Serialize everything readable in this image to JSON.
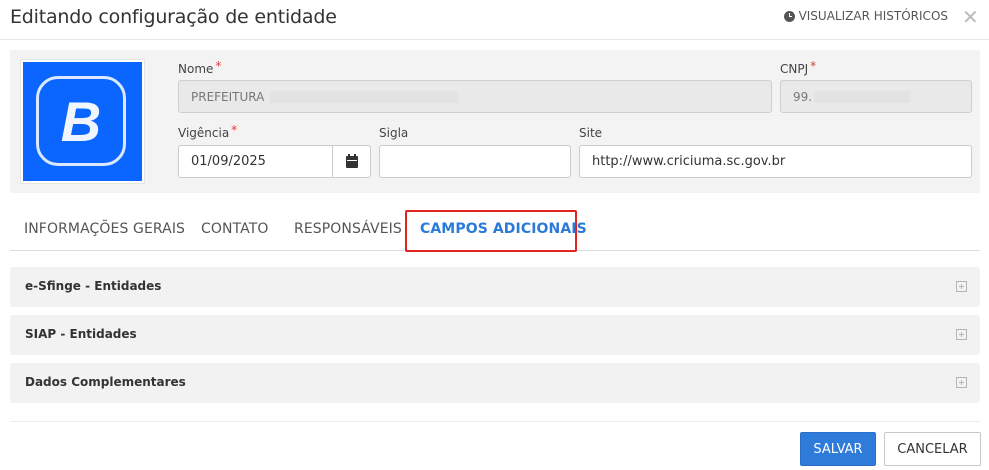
{
  "header": {
    "title": "Editando configuração de entidade",
    "history_label": "VISUALIZAR HISTÓRICOS",
    "close_glyph": "✕"
  },
  "form": {
    "nome": {
      "label": "Nome",
      "required_mark": "*",
      "value": "PREFEITURA"
    },
    "cnpj": {
      "label": "CNPJ",
      "required_mark": "*",
      "value": "99."
    },
    "vigencia": {
      "label": "Vigência",
      "required_mark": "*",
      "value": "01/09/2025"
    },
    "sigla": {
      "label": "Sigla",
      "value": ""
    },
    "site": {
      "label": "Site",
      "value": "http://www.criciuma.sc.gov.br"
    }
  },
  "logo": {
    "letter": "B",
    "color": "#0a66ff"
  },
  "tabs": [
    {
      "label": "INFORMAÇÕES GERAIS",
      "active": false
    },
    {
      "label": "CONTATO",
      "active": false
    },
    {
      "label": "RESPONSÁVEIS",
      "active": false
    },
    {
      "label": "CAMPOS ADICIONAIS",
      "active": true
    }
  ],
  "sections": [
    {
      "label": "e-Sfinge - Entidades"
    },
    {
      "label": "SIAP - Entidades"
    },
    {
      "label": "Dados Complementares"
    }
  ],
  "actions": {
    "save_label": "SALVAR",
    "cancel_label": "CANCELAR"
  },
  "colors": {
    "accent": "#2f7bd9",
    "highlight": "#e32222",
    "required": "#e53935"
  }
}
